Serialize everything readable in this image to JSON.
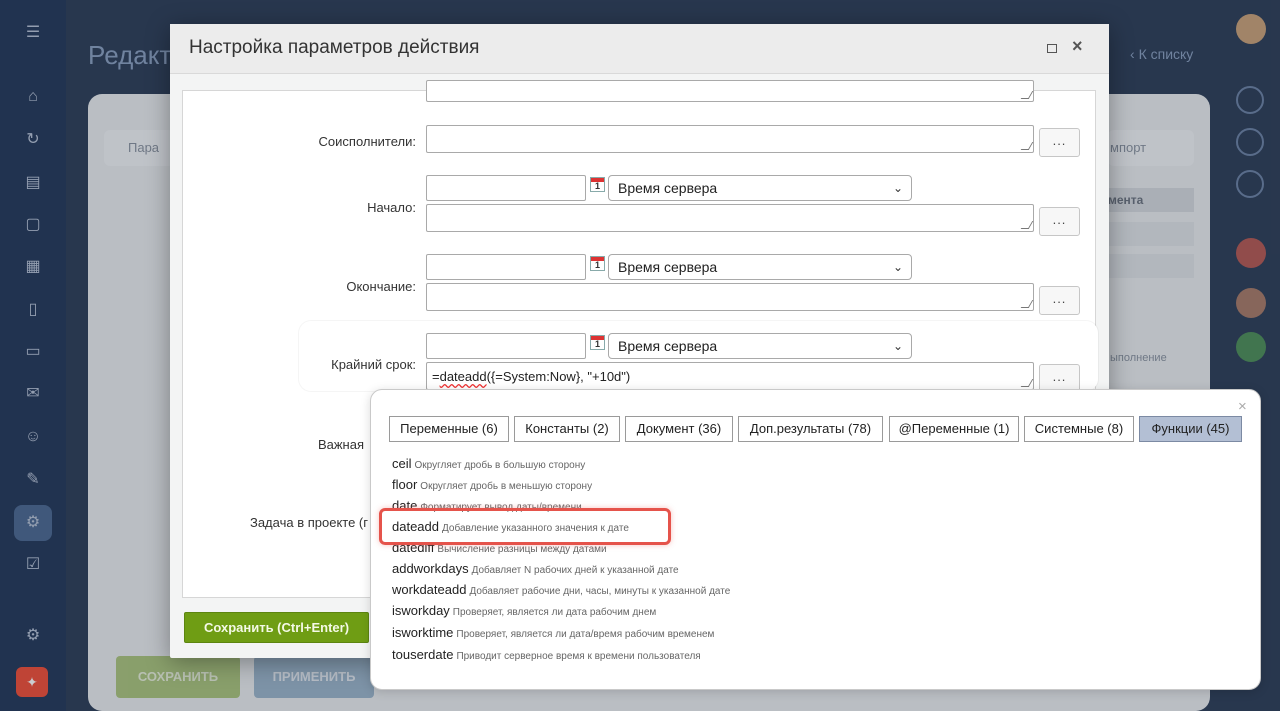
{
  "background": {
    "page_title": "Редакт",
    "back_link": "К списку",
    "tab_left": "Пара",
    "tab_right": "мпорт",
    "column_header": "мента",
    "cell_text": "ыполнение",
    "save_button": "СОХРАНИТЬ",
    "apply_button": "ПРИМЕНИТЬ"
  },
  "dialog": {
    "title": "Настройка параметров действия",
    "fields": {
      "coexecutors_label": "Соисполнители:",
      "start_label": "Начало:",
      "end_label": "Окончание:",
      "deadline_label": "Крайний срок:",
      "deadline_expression": {
        "prefix": "=",
        "func": "dateadd",
        "rest": "({=System:Now}, \"+10d\")"
      },
      "important_label": "Важная",
      "project_label": "Задача в проекте (г"
    },
    "timezone_option": "Время сервера",
    "calendar_day": "1",
    "dots_label": "...",
    "save_button": "Сохранить (Ctrl+Enter)"
  },
  "popup": {
    "tabs": [
      {
        "label": "Переменные (6)",
        "active": false
      },
      {
        "label": "Константы (2)",
        "active": false
      },
      {
        "label": "Документ (36)",
        "active": false
      },
      {
        "label": "Доп.результаты (78)",
        "active": false
      },
      {
        "label": "@Переменные (1)",
        "active": false
      },
      {
        "label": "Системные (8)",
        "active": false
      },
      {
        "label": "Функции (45)",
        "active": true
      }
    ],
    "functions": [
      {
        "name": "ceil",
        "desc": "Округляет дробь в большую сторону"
      },
      {
        "name": "floor",
        "desc": "Округляет дробь в меньшую сторону"
      },
      {
        "name": "date",
        "desc": "Форматирует вывод даты/времени"
      },
      {
        "name": "dateadd",
        "desc": "Добавление указанного значения к дате"
      },
      {
        "name": "datediff",
        "desc": "Вычисление разницы между датами"
      },
      {
        "name": "addworkdays",
        "desc": "Добавляет N рабочих дней к указанной дате"
      },
      {
        "name": "workdateadd",
        "desc": "Добавляет рабочие дни, часы, минуты к указанной дате"
      },
      {
        "name": "isworkday",
        "desc": "Проверяет, является ли дата рабочим днем"
      },
      {
        "name": "isworktime",
        "desc": "Проверяет, является ли дата/время рабочим временем"
      },
      {
        "name": "touserdate",
        "desc": "Приводит серверное время к времени пользователя"
      }
    ],
    "highlighted_function": "dateadd",
    "highlight_color": "#e5534b"
  }
}
